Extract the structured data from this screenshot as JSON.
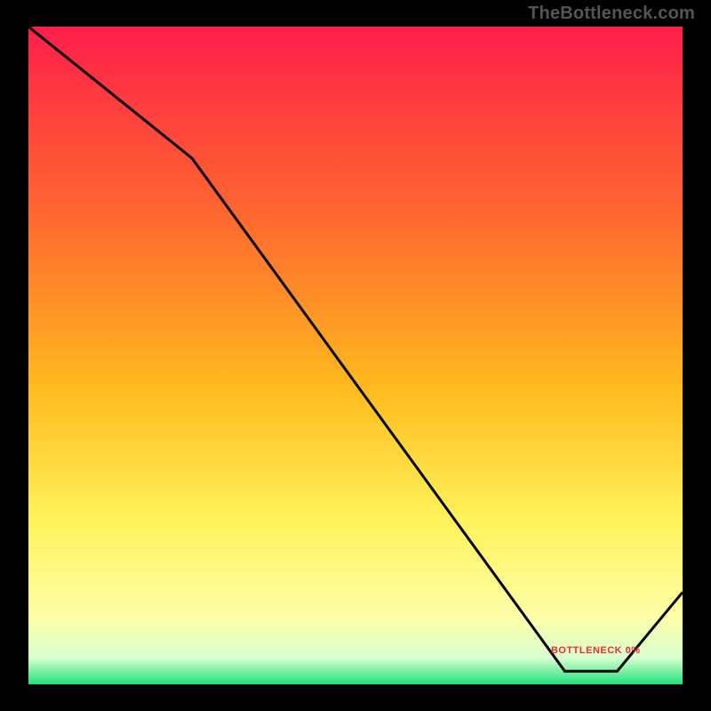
{
  "watermark": "TheBottleneck.com",
  "red_label": "BOTTLENECK 0%",
  "chart_data": {
    "type": "line",
    "title": "",
    "xlabel": "",
    "ylabel": "",
    "xlim": [
      0,
      100
    ],
    "ylim": [
      0,
      100
    ],
    "curve": [
      {
        "x": 0,
        "y": 100
      },
      {
        "x": 25,
        "y": 80
      },
      {
        "x": 82,
        "y": 2
      },
      {
        "x": 90,
        "y": 2
      },
      {
        "x": 100,
        "y": 14
      }
    ],
    "gradient_stops": [
      {
        "t": 0.0,
        "c": "#ff1f4a"
      },
      {
        "t": 0.3,
        "c": "#ff6b2e"
      },
      {
        "t": 0.55,
        "c": "#ffbb1e"
      },
      {
        "t": 0.75,
        "c": "#fff25a"
      },
      {
        "t": 0.9,
        "c": "#fdffa8"
      },
      {
        "t": 0.96,
        "c": "#d7ffcf"
      },
      {
        "t": 1.0,
        "c": "#22e07a"
      }
    ],
    "flat_label_position": {
      "x": 86,
      "y": 4
    }
  }
}
